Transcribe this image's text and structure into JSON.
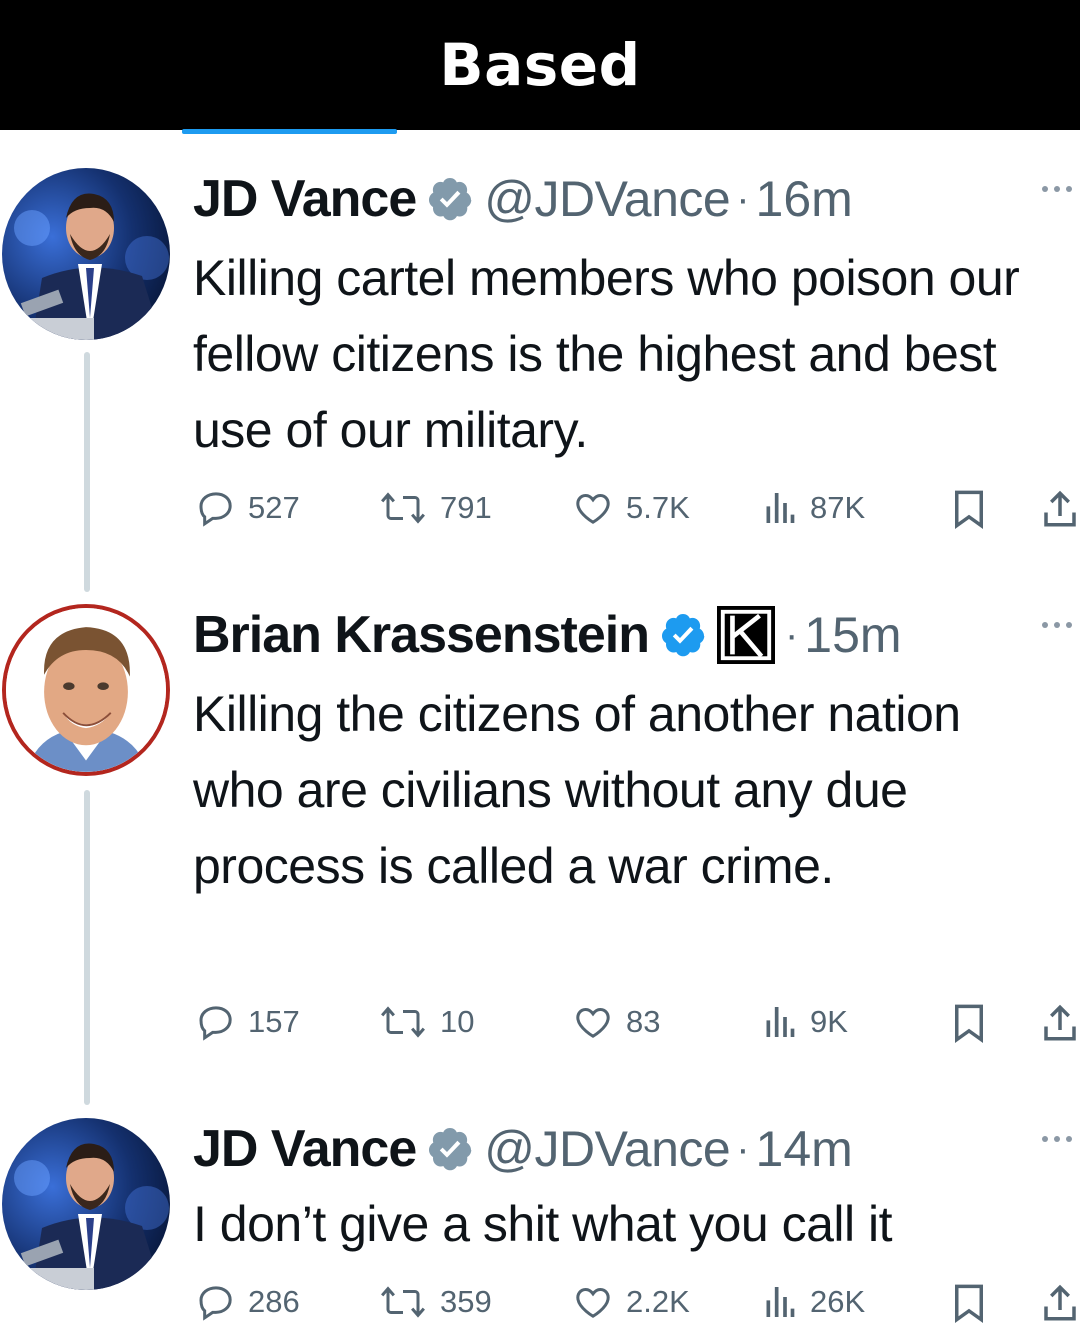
{
  "banner": {
    "title": "Based"
  },
  "tweets": [
    {
      "name": "JD Vance",
      "handle": "@JDVance",
      "separator": "·",
      "time": "16m",
      "text": "Killing cartel members who poison our fellow citizens is the highest and best use of our military.",
      "avatar_icon": "jd-vance-avatar",
      "stats": {
        "replies": "527",
        "reposts": "791",
        "likes": "5.7K",
        "views": "87K"
      }
    },
    {
      "name": "Brian Krassenstein",
      "handle": "",
      "separator": "·",
      "time": "15m",
      "text": "Killing the citizens of another nation who are civilians without any due process is called a war crime.",
      "avatar_icon": "brian-krassenstein-avatar",
      "badge_icon": "k-logo-icon",
      "stats": {
        "replies": "157",
        "reposts": "10",
        "likes": "83",
        "views": "9K"
      }
    },
    {
      "name": "JD Vance",
      "handle": "@JDVance",
      "separator": "·",
      "time": "14m",
      "text": "I don’t give a shit what you call it",
      "avatar_icon": "jd-vance-avatar",
      "stats": {
        "replies": "286",
        "reposts": "359",
        "likes": "2.2K",
        "views": "26K"
      }
    }
  ],
  "colors": {
    "verified": "#1d9bf0",
    "verified_gray": "#829aab",
    "text": "#0f1419",
    "muted": "#536471",
    "thread": "#cfd9de"
  },
  "icons": [
    "reply-icon",
    "repost-icon",
    "like-icon",
    "views-icon",
    "bookmark-icon",
    "share-icon",
    "more-icon",
    "verified-icon"
  ]
}
